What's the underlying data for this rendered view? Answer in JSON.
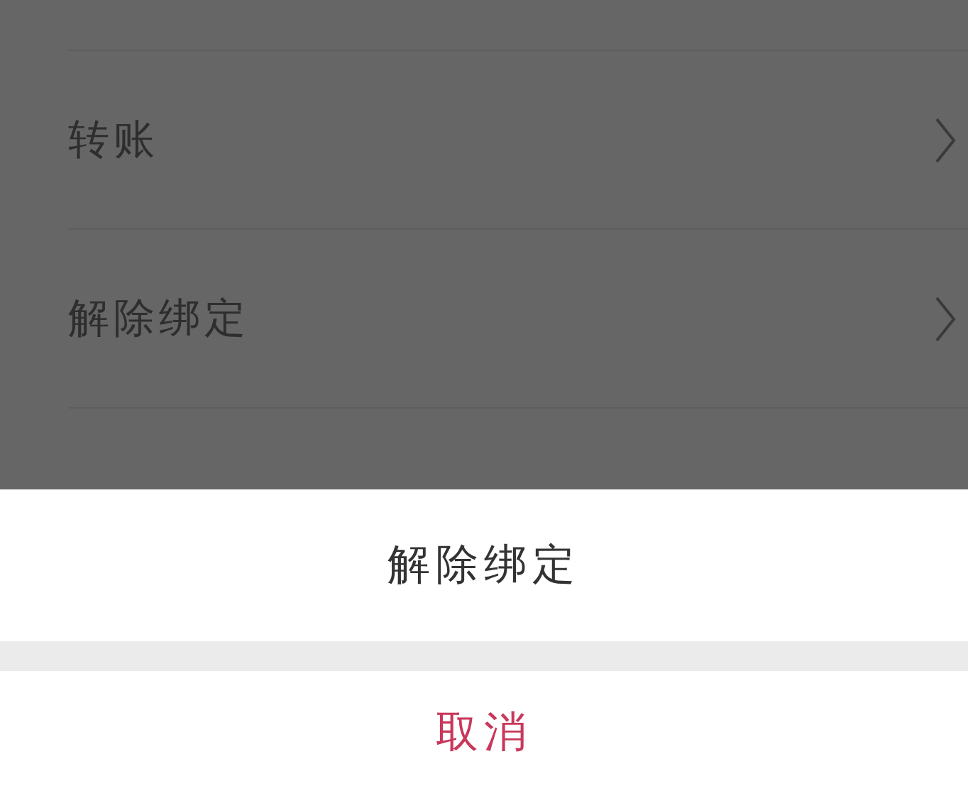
{
  "menu_items": [
    {
      "label": "转账"
    },
    {
      "label": "解除绑定"
    }
  ],
  "action_sheet": {
    "actions": [
      {
        "label": "解除绑定"
      }
    ],
    "cancel": "取消"
  }
}
